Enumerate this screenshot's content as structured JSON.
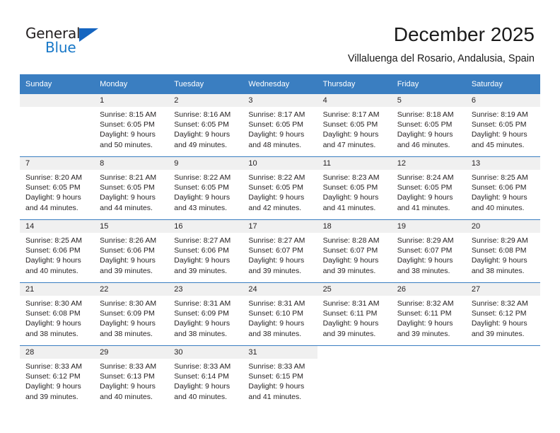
{
  "brand": {
    "name_part1": "General",
    "name_part2": "Blue",
    "accent_color": "#1878c8",
    "triangle_color": "#1565c0"
  },
  "header": {
    "title": "December 2025",
    "subtitle": "Villaluenga del Rosario, Andalusia, Spain"
  },
  "calendar": {
    "header_bg": "#3a7ec1",
    "daynum_bg": "#f0f0f0",
    "weekday_headers": [
      "Sunday",
      "Monday",
      "Tuesday",
      "Wednesday",
      "Thursday",
      "Friday",
      "Saturday"
    ],
    "weeks": [
      [
        {
          "day": "",
          "lines": []
        },
        {
          "day": "1",
          "lines": [
            "Sunrise: 8:15 AM",
            "Sunset: 6:05 PM",
            "Daylight: 9 hours",
            "and 50 minutes."
          ]
        },
        {
          "day": "2",
          "lines": [
            "Sunrise: 8:16 AM",
            "Sunset: 6:05 PM",
            "Daylight: 9 hours",
            "and 49 minutes."
          ]
        },
        {
          "day": "3",
          "lines": [
            "Sunrise: 8:17 AM",
            "Sunset: 6:05 PM",
            "Daylight: 9 hours",
            "and 48 minutes."
          ]
        },
        {
          "day": "4",
          "lines": [
            "Sunrise: 8:17 AM",
            "Sunset: 6:05 PM",
            "Daylight: 9 hours",
            "and 47 minutes."
          ]
        },
        {
          "day": "5",
          "lines": [
            "Sunrise: 8:18 AM",
            "Sunset: 6:05 PM",
            "Daylight: 9 hours",
            "and 46 minutes."
          ]
        },
        {
          "day": "6",
          "lines": [
            "Sunrise: 8:19 AM",
            "Sunset: 6:05 PM",
            "Daylight: 9 hours",
            "and 45 minutes."
          ]
        }
      ],
      [
        {
          "day": "7",
          "lines": [
            "Sunrise: 8:20 AM",
            "Sunset: 6:05 PM",
            "Daylight: 9 hours",
            "and 44 minutes."
          ]
        },
        {
          "day": "8",
          "lines": [
            "Sunrise: 8:21 AM",
            "Sunset: 6:05 PM",
            "Daylight: 9 hours",
            "and 44 minutes."
          ]
        },
        {
          "day": "9",
          "lines": [
            "Sunrise: 8:22 AM",
            "Sunset: 6:05 PM",
            "Daylight: 9 hours",
            "and 43 minutes."
          ]
        },
        {
          "day": "10",
          "lines": [
            "Sunrise: 8:22 AM",
            "Sunset: 6:05 PM",
            "Daylight: 9 hours",
            "and 42 minutes."
          ]
        },
        {
          "day": "11",
          "lines": [
            "Sunrise: 8:23 AM",
            "Sunset: 6:05 PM",
            "Daylight: 9 hours",
            "and 41 minutes."
          ]
        },
        {
          "day": "12",
          "lines": [
            "Sunrise: 8:24 AM",
            "Sunset: 6:05 PM",
            "Daylight: 9 hours",
            "and 41 minutes."
          ]
        },
        {
          "day": "13",
          "lines": [
            "Sunrise: 8:25 AM",
            "Sunset: 6:06 PM",
            "Daylight: 9 hours",
            "and 40 minutes."
          ]
        }
      ],
      [
        {
          "day": "14",
          "lines": [
            "Sunrise: 8:25 AM",
            "Sunset: 6:06 PM",
            "Daylight: 9 hours",
            "and 40 minutes."
          ]
        },
        {
          "day": "15",
          "lines": [
            "Sunrise: 8:26 AM",
            "Sunset: 6:06 PM",
            "Daylight: 9 hours",
            "and 39 minutes."
          ]
        },
        {
          "day": "16",
          "lines": [
            "Sunrise: 8:27 AM",
            "Sunset: 6:06 PM",
            "Daylight: 9 hours",
            "and 39 minutes."
          ]
        },
        {
          "day": "17",
          "lines": [
            "Sunrise: 8:27 AM",
            "Sunset: 6:07 PM",
            "Daylight: 9 hours",
            "and 39 minutes."
          ]
        },
        {
          "day": "18",
          "lines": [
            "Sunrise: 8:28 AM",
            "Sunset: 6:07 PM",
            "Daylight: 9 hours",
            "and 39 minutes."
          ]
        },
        {
          "day": "19",
          "lines": [
            "Sunrise: 8:29 AM",
            "Sunset: 6:07 PM",
            "Daylight: 9 hours",
            "and 38 minutes."
          ]
        },
        {
          "day": "20",
          "lines": [
            "Sunrise: 8:29 AM",
            "Sunset: 6:08 PM",
            "Daylight: 9 hours",
            "and 38 minutes."
          ]
        }
      ],
      [
        {
          "day": "21",
          "lines": [
            "Sunrise: 8:30 AM",
            "Sunset: 6:08 PM",
            "Daylight: 9 hours",
            "and 38 minutes."
          ]
        },
        {
          "day": "22",
          "lines": [
            "Sunrise: 8:30 AM",
            "Sunset: 6:09 PM",
            "Daylight: 9 hours",
            "and 38 minutes."
          ]
        },
        {
          "day": "23",
          "lines": [
            "Sunrise: 8:31 AM",
            "Sunset: 6:09 PM",
            "Daylight: 9 hours",
            "and 38 minutes."
          ]
        },
        {
          "day": "24",
          "lines": [
            "Sunrise: 8:31 AM",
            "Sunset: 6:10 PM",
            "Daylight: 9 hours",
            "and 38 minutes."
          ]
        },
        {
          "day": "25",
          "lines": [
            "Sunrise: 8:31 AM",
            "Sunset: 6:11 PM",
            "Daylight: 9 hours",
            "and 39 minutes."
          ]
        },
        {
          "day": "26",
          "lines": [
            "Sunrise: 8:32 AM",
            "Sunset: 6:11 PM",
            "Daylight: 9 hours",
            "and 39 minutes."
          ]
        },
        {
          "day": "27",
          "lines": [
            "Sunrise: 8:32 AM",
            "Sunset: 6:12 PM",
            "Daylight: 9 hours",
            "and 39 minutes."
          ]
        }
      ],
      [
        {
          "day": "28",
          "lines": [
            "Sunrise: 8:33 AM",
            "Sunset: 6:12 PM",
            "Daylight: 9 hours",
            "and 39 minutes."
          ]
        },
        {
          "day": "29",
          "lines": [
            "Sunrise: 8:33 AM",
            "Sunset: 6:13 PM",
            "Daylight: 9 hours",
            "and 40 minutes."
          ]
        },
        {
          "day": "30",
          "lines": [
            "Sunrise: 8:33 AM",
            "Sunset: 6:14 PM",
            "Daylight: 9 hours",
            "and 40 minutes."
          ]
        },
        {
          "day": "31",
          "lines": [
            "Sunrise: 8:33 AM",
            "Sunset: 6:15 PM",
            "Daylight: 9 hours",
            "and 41 minutes."
          ]
        },
        {
          "day": "",
          "lines": []
        },
        {
          "day": "",
          "lines": []
        },
        {
          "day": "",
          "lines": []
        }
      ]
    ]
  }
}
